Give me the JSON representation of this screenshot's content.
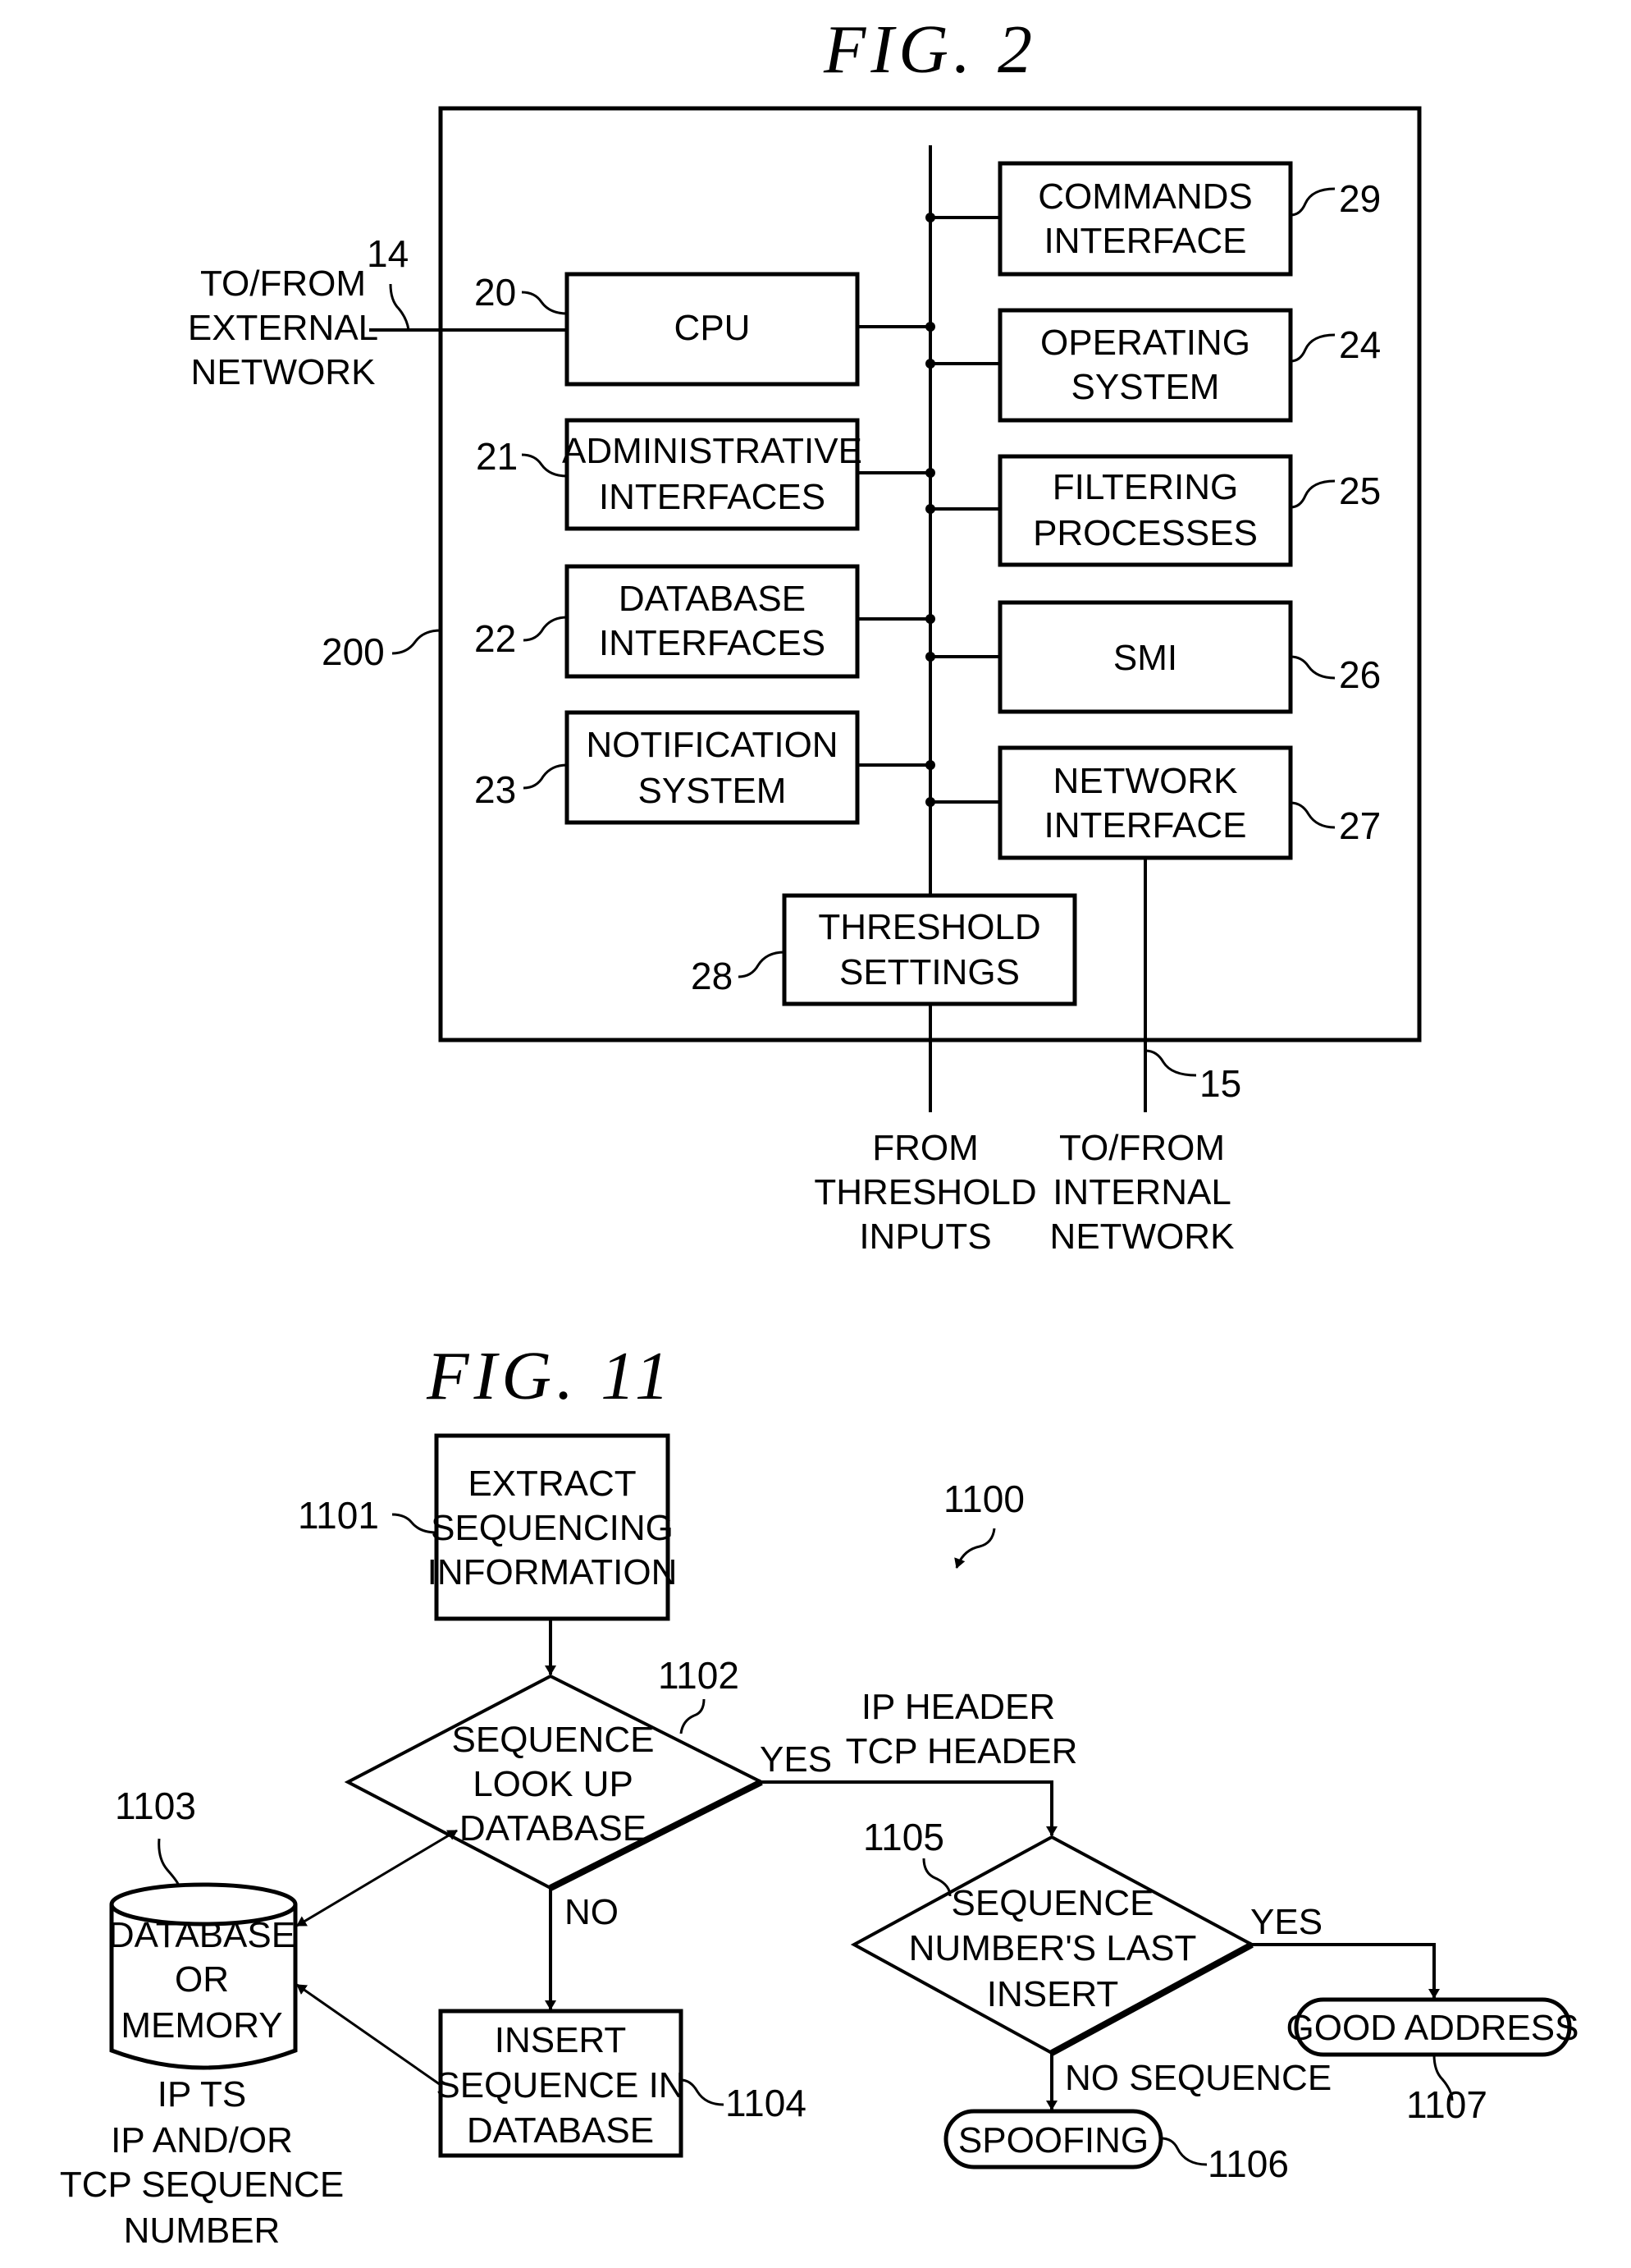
{
  "fig2": {
    "title": "FIG. 2",
    "ref_system": "200",
    "external": {
      "lines": [
        "TO/FROM",
        "EXTERNAL",
        "NETWORK"
      ],
      "ref": "14"
    },
    "left_blocks": [
      {
        "id": "cpu",
        "lines": [
          "CPU"
        ],
        "ref": "20"
      },
      {
        "id": "admin",
        "lines": [
          "ADMINISTRATIVE",
          "INTERFACES"
        ],
        "ref": "21"
      },
      {
        "id": "dbif",
        "lines": [
          "DATABASE",
          "INTERFACES"
        ],
        "ref": "22"
      },
      {
        "id": "notify",
        "lines": [
          "NOTIFICATION",
          "SYSTEM"
        ],
        "ref": "23"
      }
    ],
    "right_blocks": [
      {
        "id": "commands",
        "lines": [
          "COMMANDS",
          "INTERFACE"
        ],
        "ref": "29"
      },
      {
        "id": "os",
        "lines": [
          "OPERATING",
          "SYSTEM"
        ],
        "ref": "24"
      },
      {
        "id": "filter",
        "lines": [
          "FILTERING",
          "PROCESSES"
        ],
        "ref": "25"
      },
      {
        "id": "smi",
        "lines": [
          "SMI"
        ],
        "ref": "26"
      },
      {
        "id": "netif",
        "lines": [
          "NETWORK",
          "INTERFACE"
        ],
        "ref": "27"
      }
    ],
    "threshold": {
      "lines": [
        "THRESHOLD",
        "SETTINGS"
      ],
      "ref": "28"
    },
    "threshold_inputs": [
      "FROM",
      "THRESHOLD",
      "INPUTS"
    ],
    "internal": {
      "lines": [
        "TO/FROM",
        "INTERNAL",
        "NETWORK"
      ],
      "ref": "15"
    }
  },
  "fig11": {
    "title": "FIG. 11",
    "ref_flow": "1100",
    "extract": {
      "lines": [
        "EXTRACT",
        "SEQUENCING",
        "INFORMATION"
      ],
      "ref": "1101"
    },
    "lookup": {
      "lines": [
        "SEQUENCE",
        "LOOK UP",
        "DATABASE"
      ],
      "ref": "1102",
      "yes": "YES",
      "no": "NO"
    },
    "database": {
      "lines": [
        "DATABASE",
        "OR",
        "MEMORY"
      ],
      "ref": "1103",
      "caption": [
        "IP TS",
        "IP AND/OR",
        "TCP SEQUENCE",
        "NUMBER"
      ]
    },
    "insert": {
      "lines": [
        "INSERT",
        "SEQUENCE IN",
        "DATABASE"
      ],
      "ref": "1104"
    },
    "headers": [
      "IP HEADER",
      "TCP HEADER"
    ],
    "check": {
      "lines": [
        "SEQUENCE",
        "NUMBER'S LAST",
        "INSERT"
      ],
      "ref": "1105",
      "yes": "YES",
      "no": "NO SEQUENCE"
    },
    "spoofing": {
      "label": "SPOOFING",
      "ref": "1106"
    },
    "good": {
      "label": "GOOD ADDRESS",
      "ref": "1107"
    }
  }
}
